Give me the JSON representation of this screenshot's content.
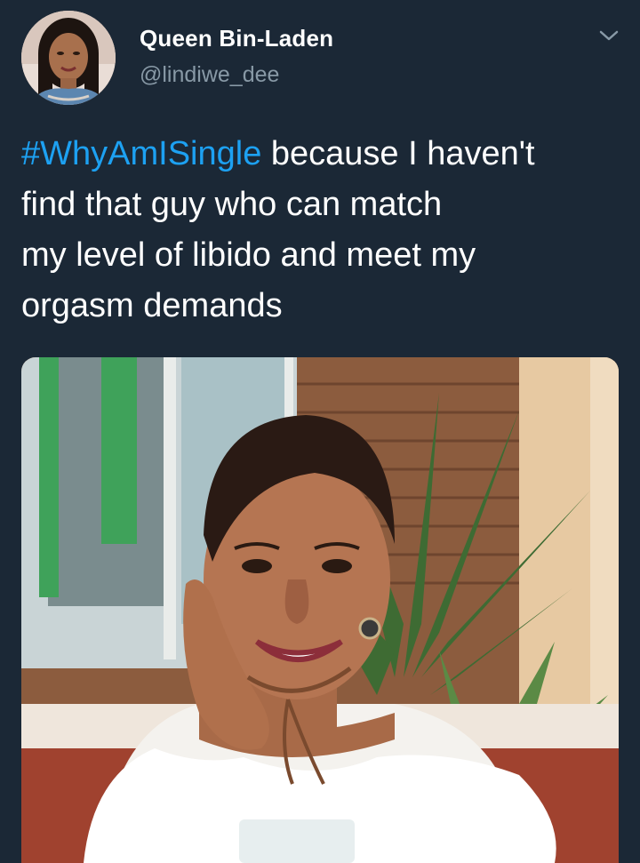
{
  "tweet": {
    "display_name": "Queen Bin-Laden",
    "handle": "@lindiwe_dee",
    "hashtag": "#WhyAmISingle",
    "body_line1": " because I haven't",
    "body_rest": "find that guy who can match\nmy level of libido and meet my\norgasm demands",
    "menu_icon": "chevron-down-icon",
    "media_description_icon": "photo"
  },
  "colors": {
    "background": "#1b2836",
    "hashtag": "#1da1f2",
    "handle": "#8899a6",
    "text": "#ffffff"
  }
}
